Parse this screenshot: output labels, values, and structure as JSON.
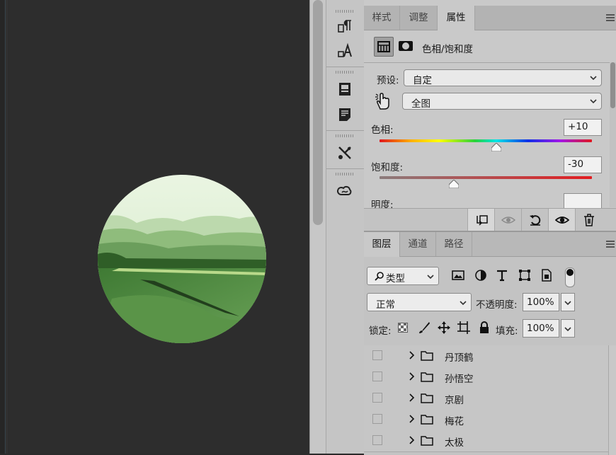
{
  "properties_panel": {
    "tabs": [
      {
        "label": "样式",
        "active": false
      },
      {
        "label": "调整",
        "active": false
      },
      {
        "label": "属性",
        "active": true
      }
    ],
    "title": "色相/饱和度",
    "preset_label": "预设:",
    "preset_value": "自定",
    "channel_value": "全图",
    "hue": {
      "label": "色相:",
      "value": "+10",
      "fraction": 0.55
    },
    "saturation": {
      "label": "饱和度:",
      "value": "-30",
      "fraction": 0.35
    },
    "lightness": {
      "label": "明度:",
      "value": ""
    },
    "footer_icons": [
      "clip-to-layer-icon",
      "view-previous-icon",
      "reset-icon",
      "visibility-icon",
      "delete-icon"
    ]
  },
  "layers_panel": {
    "tabs": [
      {
        "label": "图层",
        "active": true
      },
      {
        "label": "通道",
        "active": false
      },
      {
        "label": "路径",
        "active": false
      }
    ],
    "filter_label": "类型",
    "filter_icons": [
      "image-filter-icon",
      "adjustment-filter-icon",
      "type-filter-icon",
      "shape-filter-icon",
      "smart-object-filter-icon",
      "filter-toggle-icon"
    ],
    "blend_mode": "正常",
    "opacity_label": "不透明度:",
    "opacity_value": "100%",
    "lock_label": "锁定:",
    "lock_icons": [
      "lock-transparent-icon",
      "lock-image-icon",
      "lock-position-icon",
      "lock-artboard-icon",
      "lock-all-icon"
    ],
    "fill_label": "填充:",
    "fill_value": "100%",
    "layers": [
      {
        "name": "丹顶鹤",
        "type": "group"
      },
      {
        "name": "孙悟空",
        "type": "group"
      },
      {
        "name": "京剧",
        "type": "group"
      },
      {
        "name": "梅花",
        "type": "group"
      },
      {
        "name": "太极",
        "type": "group"
      }
    ]
  },
  "icon_strip": [
    "paragraph-icon",
    "character-icon",
    "properties-icon",
    "notes-icon",
    "tool-presets-icon",
    "libraries-icon"
  ],
  "colors": {
    "canvas_bg": "#2d2d2d",
    "panel_bg": "#c9c9c9",
    "landscape_green": "#4f8a3c"
  }
}
